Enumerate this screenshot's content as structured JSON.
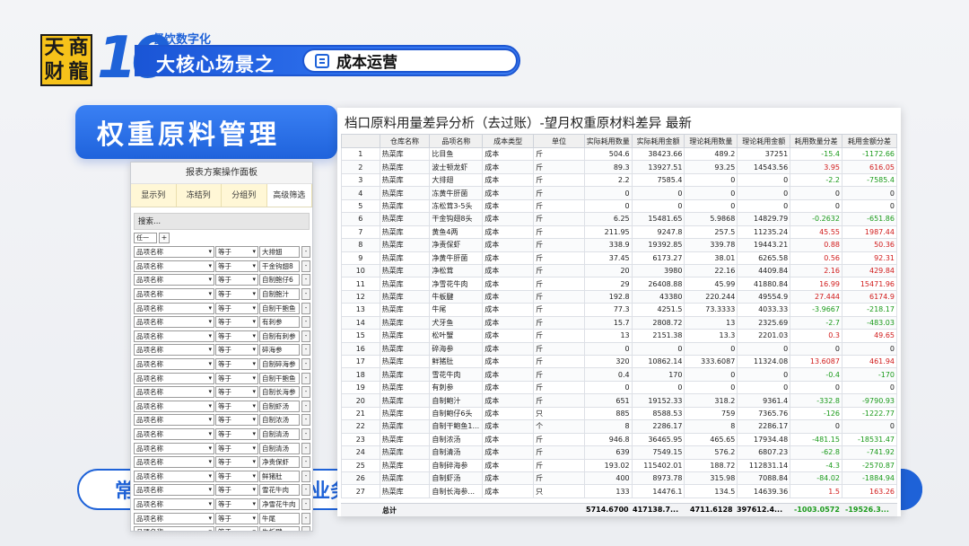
{
  "header": {
    "logo_chars": [
      "天",
      "商",
      "财",
      "龍"
    ],
    "big_number": "10",
    "sub_title": "餐饮数字化",
    "main_title": "大核心场景之",
    "pill_text": "成本运营"
  },
  "section": {
    "tag": "权重原料管理"
  },
  "bottom": {
    "left_text": "常",
    "mid_text": "业务"
  },
  "panel": {
    "title": "报表方案操作面板",
    "tabs": [
      "显示列",
      "冻结列",
      "分组列",
      "高级筛选"
    ],
    "active_tab": 3,
    "search_label": "搜索...",
    "logic_select": "任一",
    "add_button": "+",
    "filters": [
      {
        "field": "品项名称",
        "op": "等于",
        "value": "大排翅",
        "del": "-"
      },
      {
        "field": "品项名称",
        "op": "等于",
        "value": "干金钩翅8",
        "del": "-"
      },
      {
        "field": "品项名称",
        "op": "等于",
        "value": "自制鲍仔6",
        "del": "-"
      },
      {
        "field": "品项名称",
        "op": "等于",
        "value": "自制鲍汁",
        "del": "-"
      },
      {
        "field": "品项名称",
        "op": "等于",
        "value": "自制干鲍鱼",
        "del": "-"
      },
      {
        "field": "品项名称",
        "op": "等于",
        "value": "有刺参",
        "del": "-"
      },
      {
        "field": "品项名称",
        "op": "等于",
        "value": "自制有刺参",
        "del": "-"
      },
      {
        "field": "品项名称",
        "op": "等于",
        "value": "碎海参",
        "del": "-"
      },
      {
        "field": "品项名称",
        "op": "等于",
        "value": "自制碎海参",
        "del": "-"
      },
      {
        "field": "品项名称",
        "op": "等于",
        "value": "自制干鲍鱼",
        "del": "-"
      },
      {
        "field": "品项名称",
        "op": "等于",
        "value": "自制长海参",
        "del": "-"
      },
      {
        "field": "品项名称",
        "op": "等于",
        "value": "自制虾汤",
        "del": "-"
      },
      {
        "field": "品项名称",
        "op": "等于",
        "value": "自制浓汤",
        "del": "-"
      },
      {
        "field": "品项名称",
        "op": "等于",
        "value": "自制清汤",
        "del": "-"
      },
      {
        "field": "品项名称",
        "op": "等于",
        "value": "自制清汤",
        "del": "-"
      },
      {
        "field": "品项名称",
        "op": "等于",
        "value": "净责保虾",
        "del": "-"
      },
      {
        "field": "品项名称",
        "op": "等于",
        "value": "鲜猪肚",
        "del": "-"
      },
      {
        "field": "品项名称",
        "op": "等于",
        "value": "雪花牛肉",
        "del": "-"
      },
      {
        "field": "品项名称",
        "op": "等于",
        "value": "净雪花牛肉",
        "del": "-"
      },
      {
        "field": "品项名称",
        "op": "等于",
        "value": "牛尾",
        "del": "-"
      },
      {
        "field": "品项名称",
        "op": "等于",
        "value": "牛板腱",
        "del": "-"
      },
      {
        "field": "品项名称",
        "op": "等于",
        "value": "犬牙鱼",
        "del": "-"
      }
    ]
  },
  "table": {
    "title": "档口原料用量差异分析（去过账）-望月权重原材料差异 最新",
    "columns": [
      "",
      "仓库名称",
      "品项名称",
      "成本类型",
      "单位",
      "实际耗用数量",
      "实际耗用金额",
      "理论耗用数量",
      "理论耗用金额",
      "耗用数量分差",
      "耗用金额分差"
    ],
    "rows": [
      [
        "1",
        "热菜库",
        "比目鱼",
        "成本",
        "斤",
        "504.6",
        "38423.66",
        "489.2",
        "37251",
        "-15.4",
        "-1172.66"
      ],
      [
        "2",
        "热菜库",
        "波士顿龙虾",
        "成本",
        "斤",
        "89.3",
        "13927.51",
        "93.25",
        "14543.56",
        "3.95",
        "616.05"
      ],
      [
        "3",
        "热菜库",
        "大排翅",
        "成本",
        "斤",
        "2.2",
        "7585.4",
        "0",
        "0",
        "-2.2",
        "-7585.4"
      ],
      [
        "4",
        "热菜库",
        "冻黄牛肝菌",
        "成本",
        "斤",
        "0",
        "0",
        "0",
        "0",
        "0",
        "0"
      ],
      [
        "5",
        "热菜库",
        "冻松茸3-5头",
        "成本",
        "斤",
        "0",
        "0",
        "0",
        "0",
        "0",
        "0"
      ],
      [
        "6",
        "热菜库",
        "干金钩翅8头",
        "成本",
        "斤",
        "6.25",
        "15481.65",
        "5.9868",
        "14829.79",
        "-0.2632",
        "-651.86"
      ],
      [
        "7",
        "热菜库",
        "黄鱼4两",
        "成本",
        "斤",
        "211.95",
        "9247.8",
        "257.5",
        "11235.24",
        "45.55",
        "1987.44"
      ],
      [
        "8",
        "热菜库",
        "净责保虾",
        "成本",
        "斤",
        "338.9",
        "19392.85",
        "339.78",
        "19443.21",
        "0.88",
        "50.36"
      ],
      [
        "9",
        "热菜库",
        "净黄牛肝菌",
        "成本",
        "斤",
        "37.45",
        "6173.27",
        "38.01",
        "6265.58",
        "0.56",
        "92.31"
      ],
      [
        "10",
        "热菜库",
        "净松茸",
        "成本",
        "斤",
        "20",
        "3980",
        "22.16",
        "4409.84",
        "2.16",
        "429.84"
      ],
      [
        "11",
        "热菜库",
        "净雪花牛肉",
        "成本",
        "斤",
        "29",
        "26408.88",
        "45.99",
        "41880.84",
        "16.99",
        "15471.96"
      ],
      [
        "12",
        "热菜库",
        "牛板腱",
        "成本",
        "斤",
        "192.8",
        "43380",
        "220.244",
        "49554.9",
        "27.444",
        "6174.9"
      ],
      [
        "13",
        "热菜库",
        "牛尾",
        "成本",
        "斤",
        "77.3",
        "4251.5",
        "73.3333",
        "4033.33",
        "-3.9667",
        "-218.17"
      ],
      [
        "14",
        "热菜库",
        "犬牙鱼",
        "成本",
        "斤",
        "15.7",
        "2808.72",
        "13",
        "2325.69",
        "-2.7",
        "-483.03"
      ],
      [
        "15",
        "热菜库",
        "松叶蟹",
        "成本",
        "斤",
        "13",
        "2151.38",
        "13.3",
        "2201.03",
        "0.3",
        "49.65"
      ],
      [
        "16",
        "热菜库",
        "碎海参",
        "成本",
        "斤",
        "0",
        "0",
        "0",
        "0",
        "0",
        "0"
      ],
      [
        "17",
        "热菜库",
        "鲜猪肚",
        "成本",
        "斤",
        "320",
        "10862.14",
        "333.6087",
        "11324.08",
        "13.6087",
        "461.94"
      ],
      [
        "18",
        "热菜库",
        "雪花牛肉",
        "成本",
        "斤",
        "0.4",
        "170",
        "0",
        "0",
        "-0.4",
        "-170"
      ],
      [
        "19",
        "热菜库",
        "有刺参",
        "成本",
        "斤",
        "0",
        "0",
        "0",
        "0",
        "0",
        "0"
      ],
      [
        "20",
        "热菜库",
        "自制鲍汁",
        "成本",
        "斤",
        "651",
        "19152.33",
        "318.2",
        "9361.4",
        "-332.8",
        "-9790.93"
      ],
      [
        "21",
        "热菜库",
        "自制鲍仔6头",
        "成本",
        "只",
        "885",
        "8588.53",
        "759",
        "7365.76",
        "-126",
        "-1222.77"
      ],
      [
        "22",
        "热菜库",
        "自制干鲍鱼1...",
        "成本",
        "个",
        "8",
        "2286.17",
        "8",
        "2286.17",
        "0",
        "0"
      ],
      [
        "23",
        "热菜库",
        "自制浓汤",
        "成本",
        "斤",
        "946.8",
        "36465.95",
        "465.65",
        "17934.48",
        "-481.15",
        "-18531.47"
      ],
      [
        "24",
        "热菜库",
        "自制清汤",
        "成本",
        "斤",
        "639",
        "7549.15",
        "576.2",
        "6807.23",
        "-62.8",
        "-741.92"
      ],
      [
        "25",
        "热菜库",
        "自制碎海参",
        "成本",
        "斤",
        "193.02",
        "115402.01",
        "188.72",
        "112831.14",
        "-4.3",
        "-2570.87"
      ],
      [
        "26",
        "热菜库",
        "自制虾汤",
        "成本",
        "斤",
        "400",
        "8973.78",
        "315.98",
        "7088.84",
        "-84.02",
        "-1884.94"
      ],
      [
        "27",
        "热菜库",
        "自制长海参...",
        "成本",
        "只",
        "133",
        "14476.1",
        "134.5",
        "14639.36",
        "1.5",
        "163.26"
      ]
    ],
    "total": {
      "label": "总计",
      "actual_qty": "5714.6700",
      "actual_amt": "417138.7...",
      "theory_qty": "4711.6128",
      "theory_amt": "397612.4...",
      "qty_diff": "-1003.0572",
      "amt_diff": "-19526.3..."
    }
  },
  "colors": {
    "accent": "#1e62d8",
    "negative": "#1a9a1a",
    "positive": "#d11b1b",
    "logo_bg": "#f6c21a"
  }
}
